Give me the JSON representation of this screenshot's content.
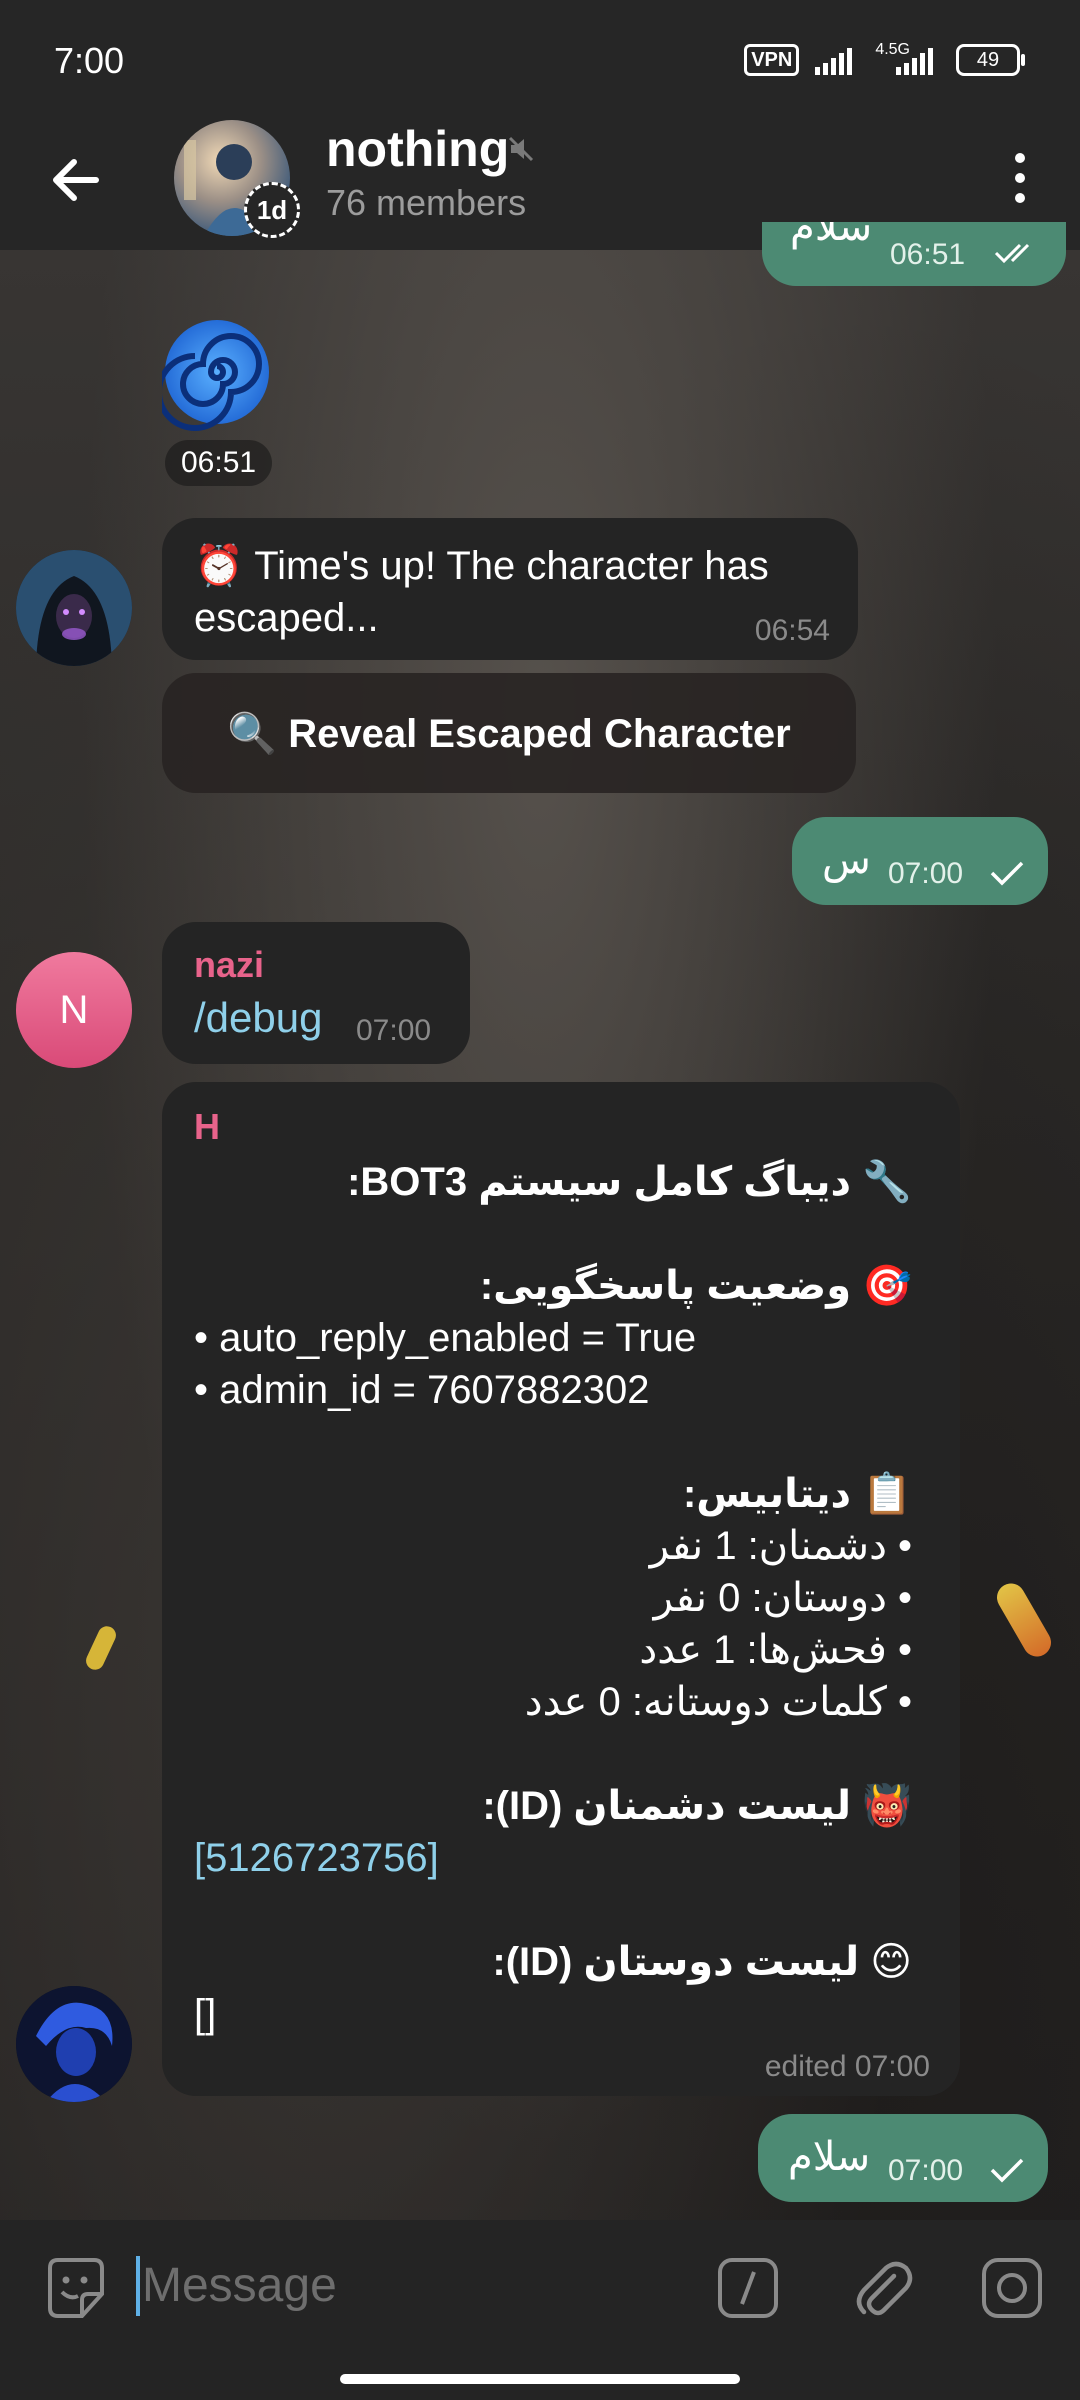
{
  "status_bar": {
    "time": "7:00",
    "vpn": "VPN",
    "network": "4.5G",
    "battery": "49"
  },
  "header": {
    "title": "nothing",
    "subtitle": "76 members",
    "story_badge": "1d"
  },
  "messages": {
    "top_partial_time": "06:51",
    "top_partial_text": "سلام",
    "sticker_time": "06:51",
    "bot_timeout": {
      "emoji": "⏰",
      "text": "Time's up! The character has escaped...",
      "time": "06:54"
    },
    "reveal_button": "🔍 Reveal Escaped Character",
    "out_s": {
      "text": "س",
      "time": "07:00"
    },
    "nazi": {
      "avatar_letter": "N",
      "sender": "nazi",
      "text": "/debug",
      "time": "07:00"
    },
    "debug": {
      "sender": "H",
      "line_title": "🔧 دیباگ کامل سیستم BOT3:",
      "line_status": "🎯 وضعیت پاسخگویی:",
      "line_auto": "• auto_reply_enabled = True",
      "line_admin": "• admin_id = 7607882302",
      "line_db": "📋 دیتابیس:",
      "line_enemies": "• دشمنان: 1 نفر",
      "line_friends": "• دوستان: 0 نفر",
      "line_insults": "• فحش‌ها: 1 عدد",
      "line_friendly": "• کلمات دوستانه: 0 عدد",
      "line_enemy_list": "👹 لیست دشمنان (ID):",
      "enemy_ids": "[5126723756]",
      "line_friend_list": "😊 لیست دوستان (ID):",
      "friend_ids": "[]",
      "time": "edited 07:00"
    },
    "out_salam": {
      "text": "سلام",
      "time": "07:00"
    }
  },
  "input": {
    "placeholder": "Message"
  },
  "colors": {
    "outgoing": "#4c8a73",
    "incoming": "#242424",
    "nazi_accent": "#e8638b",
    "link": "#8fd0ea"
  }
}
